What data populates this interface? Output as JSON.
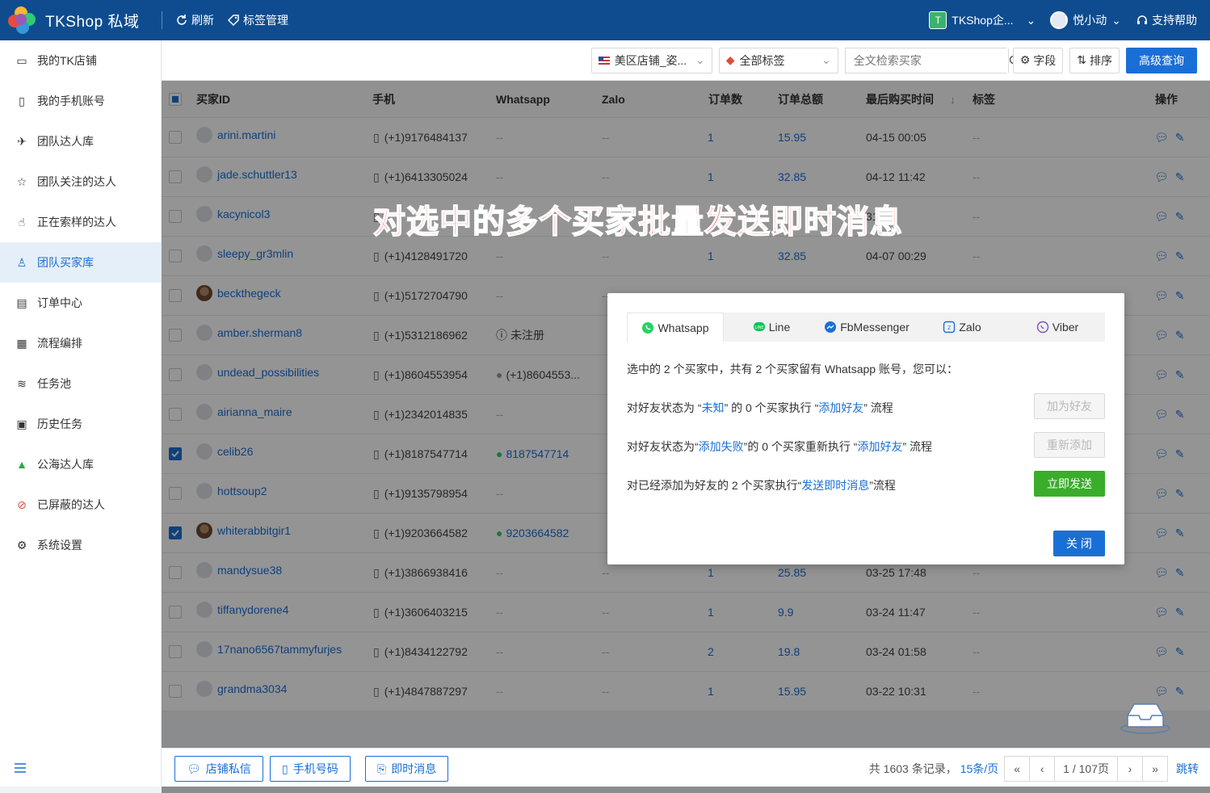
{
  "app": {
    "name": "TKShop 私域",
    "refresh": "刷新",
    "tag_manage": "标签管理",
    "company": "TKShop企...",
    "user": "悦小动",
    "help": "支持帮助",
    "company_badge": "T"
  },
  "sidebar": {
    "items": [
      {
        "label": "我的TK店铺",
        "icon": "store-icon"
      },
      {
        "label": "我的手机账号",
        "icon": "phone-icon"
      },
      {
        "label": "团队达人库",
        "icon": "creator-icon"
      },
      {
        "label": "团队关注的达人",
        "icon": "star-icon"
      },
      {
        "label": "正在索样的达人",
        "icon": "hand-icon"
      },
      {
        "label": "团队买家库",
        "icon": "user-icon",
        "active": true
      },
      {
        "label": "订单中心",
        "icon": "order-icon"
      },
      {
        "label": "流程编排",
        "icon": "flow-icon"
      },
      {
        "label": "任务池",
        "icon": "layers-icon"
      },
      {
        "label": "历史任务",
        "icon": "clipboard-icon"
      },
      {
        "label": "公海达人库",
        "icon": "mountain-icon"
      },
      {
        "label": "已屏蔽的达人",
        "icon": "block-icon"
      },
      {
        "label": "系统设置",
        "icon": "gear-icon"
      }
    ]
  },
  "filters": {
    "shop": "美区店铺_姿...",
    "tags": "全部标签",
    "search_placeholder": "全文检索买家",
    "fields": "字段",
    "sort": "排序",
    "advanced": "高级查询"
  },
  "table": {
    "columns": [
      "买家ID",
      "手机",
      "Whatsapp",
      "Zalo",
      "订单数",
      "订单总额",
      "最后购买时间",
      "标签",
      "操作"
    ],
    "rows": [
      {
        "id": "arini.martini",
        "phone": "(+1)9176484137",
        "whatsapp": "--",
        "zalo": "--",
        "orders": "1",
        "total": "15.95",
        "last": "04-15 00:05",
        "tag": "--",
        "checked": false,
        "photo": false,
        "wa_type": "none"
      },
      {
        "id": "jade.schuttler13",
        "phone": "(+1)6413305024",
        "whatsapp": "--",
        "zalo": "--",
        "orders": "1",
        "total": "32.85",
        "last": "04-12 11:42",
        "tag": "--",
        "checked": false,
        "photo": false,
        "wa_type": "none"
      },
      {
        "id": "kacynicol3",
        "phone": "",
        "whatsapp": "",
        "zalo": "",
        "orders": "",
        "total": "",
        "last": "31",
        "tag": "--",
        "checked": false,
        "photo": false,
        "wa_type": "none"
      },
      {
        "id": "sleepy_gr3mlin",
        "phone": "(+1)4128491720",
        "whatsapp": "--",
        "zalo": "--",
        "orders": "1",
        "total": "32.85",
        "last": "04-07 00:29",
        "tag": "--",
        "checked": false,
        "photo": false,
        "wa_type": "none"
      },
      {
        "id": "beckthegeck",
        "phone": "(+1)5172704790",
        "whatsapp": "--",
        "zalo": "--",
        "orders": "",
        "total": "",
        "last": "",
        "tag": "",
        "checked": false,
        "photo": true,
        "wa_type": "none"
      },
      {
        "id": "amber.sherman8",
        "phone": "(+1)5312186962",
        "whatsapp": "未注册",
        "zalo": "",
        "orders": "",
        "total": "",
        "last": "",
        "tag": "",
        "checked": false,
        "photo": false,
        "wa_type": "unreg"
      },
      {
        "id": "undead_possibilities",
        "phone": "(+1)8604553954",
        "whatsapp": "(+1)8604553...",
        "zalo": "",
        "orders": "",
        "total": "",
        "last": "",
        "tag": "",
        "checked": false,
        "photo": false,
        "wa_type": "grey"
      },
      {
        "id": "airianna_maire",
        "phone": "(+1)2342014835",
        "whatsapp": "--",
        "zalo": "",
        "orders": "",
        "total": "",
        "last": "",
        "tag": "",
        "checked": false,
        "photo": false,
        "wa_type": "none"
      },
      {
        "id": "celib26",
        "phone": "(+1)8187547714",
        "whatsapp": "8187547714",
        "zalo": "",
        "orders": "",
        "total": "",
        "last": "",
        "tag": "",
        "checked": true,
        "photo": false,
        "wa_type": "green"
      },
      {
        "id": "hottsoup2",
        "phone": "(+1)9135798954",
        "whatsapp": "--",
        "zalo": "",
        "orders": "",
        "total": "",
        "last": "",
        "tag": "",
        "checked": false,
        "photo": false,
        "wa_type": "none"
      },
      {
        "id": "whiterabbitgir1",
        "phone": "(+1)9203664582",
        "whatsapp": "9203664582",
        "zalo": "",
        "orders": "",
        "total": "",
        "last": "",
        "tag": "",
        "checked": true,
        "photo": true,
        "wa_type": "green"
      },
      {
        "id": "mandysue38",
        "phone": "(+1)3866938416",
        "whatsapp": "--",
        "zalo": "--",
        "orders": "1",
        "total": "25.85",
        "last": "03-25 17:48",
        "tag": "--",
        "checked": false,
        "photo": false,
        "wa_type": "none"
      },
      {
        "id": "tiffanydorene4",
        "phone": "(+1)3606403215",
        "whatsapp": "--",
        "zalo": "--",
        "orders": "1",
        "total": "9.9",
        "last": "03-24 11:47",
        "tag": "--",
        "checked": false,
        "photo": false,
        "wa_type": "none"
      },
      {
        "id": "17nano6567tammyfurjes",
        "phone": "(+1)8434122792",
        "whatsapp": "--",
        "zalo": "--",
        "orders": "2",
        "total": "19.8",
        "last": "03-24 01:58",
        "tag": "--",
        "checked": false,
        "photo": false,
        "wa_type": "none"
      },
      {
        "id": "grandma3034",
        "phone": "(+1)4847887297",
        "whatsapp": "--",
        "zalo": "--",
        "orders": "1",
        "total": "15.95",
        "last": "03-22 10:31",
        "tag": "--",
        "checked": false,
        "photo": false,
        "wa_type": "none"
      }
    ]
  },
  "overlay_title": "对选中的多个买家批量发送即时消息",
  "modal": {
    "tabs": [
      "Whatsapp",
      "Line",
      "FbMessenger",
      "Zalo",
      "Viber"
    ],
    "summary": "选中的 2 个买家中，共有 2 个买家留有 Whatsapp 账号，您可以：",
    "line1": {
      "pre": "对好友状态为 “",
      "status": "未知",
      "mid": "” 的 0 个买家执行 “",
      "action": "添加好友",
      "post": "” 流程",
      "button": "加为好友"
    },
    "line2": {
      "pre": "对好友状态为“",
      "status": "添加失败",
      "mid": "”的 0 个买家重新执行 “",
      "action": "添加好友",
      "post": "” 流程",
      "button": "重新添加"
    },
    "line3": {
      "pre": "对已经添加为好友的 2 个买家执行“",
      "action": "发送即时消息",
      "post": "”流程",
      "button": "立即发送"
    },
    "close": "关 闭"
  },
  "bottom": {
    "btn1": "店铺私信",
    "btn2": "手机号码",
    "btn3": "即时消息",
    "total": "共 1603 条记录，",
    "page_size": "15条/页",
    "page": "1 / 107页",
    "jump": "跳转"
  },
  "colors": {
    "brand": "#0f4c8f",
    "primary": "#1a6fd6",
    "whatsapp": "#25d366",
    "success": "#3aad2b",
    "overlay_text": "#ff3b3b"
  }
}
